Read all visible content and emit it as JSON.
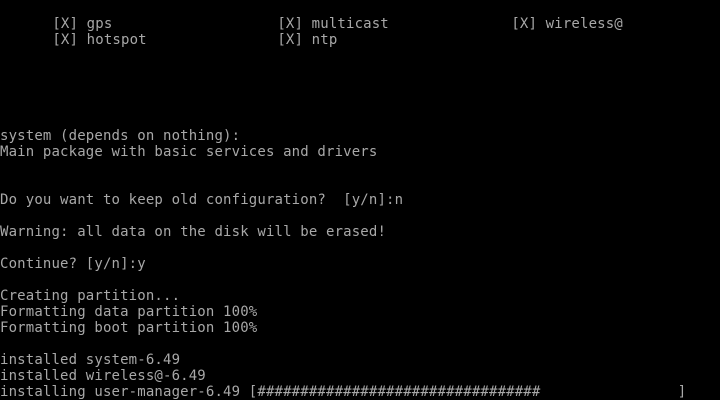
{
  "terminal": {
    "packages": [
      {
        "mark": "[X]",
        "name": "gps"
      },
      {
        "mark": "[X]",
        "name": "multicast"
      },
      {
        "mark": "[X]",
        "name": "wireless@"
      },
      {
        "mark": "[X]",
        "name": "hotspot"
      },
      {
        "mark": "[X]",
        "name": "ntp"
      }
    ],
    "desc_title": "system (depends on nothing):",
    "desc_text": "Main package with basic services and drivers",
    "keep_config_prompt": "Do you want to keep old configuration?  [y/n]:n",
    "warning": "Warning: all data on the disk will be erased!",
    "continue_prompt": "Continue? [y/n]:y",
    "creating_partition": "Creating partition...",
    "format_data": "Formatting data partition 100%",
    "format_boot": "Formatting boot partition 100%",
    "installed_system": "installed system-6.49",
    "installed_wireless": "installed wireless@-6.49",
    "installing_line": "installing user-manager-6.49 [#################################                ]"
  },
  "colors": {
    "background": "#000000",
    "text": "#a8a8a8"
  }
}
